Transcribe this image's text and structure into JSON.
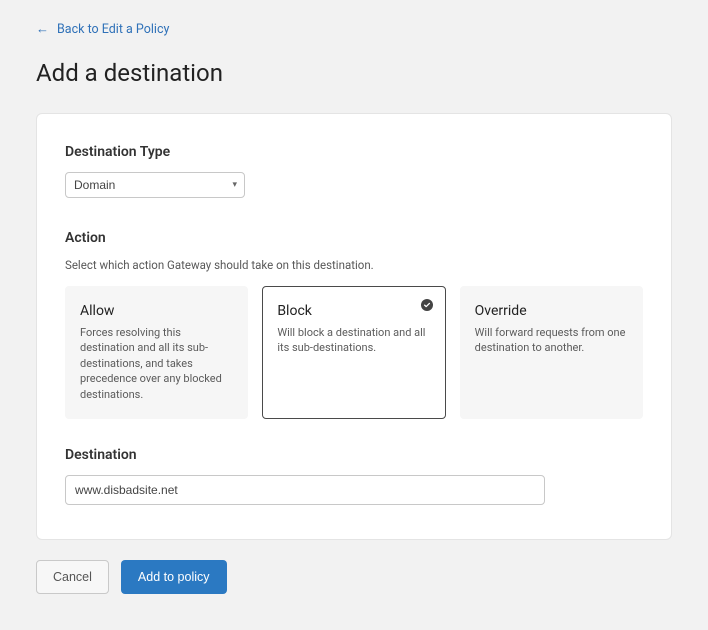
{
  "back_link": "Back to Edit a Policy",
  "page_title": "Add a destination",
  "destination_type": {
    "label": "Destination Type",
    "selected": "Domain"
  },
  "action": {
    "label": "Action",
    "hint": "Select which action Gateway should take on this destination.",
    "options": [
      {
        "title": "Allow",
        "desc": "Forces resolving this destination and all its sub-destinations, and takes precedence over any blocked destinations.",
        "selected": false
      },
      {
        "title": "Block",
        "desc": "Will block a destination and all its sub-destinations.",
        "selected": true
      },
      {
        "title": "Override",
        "desc": "Will forward requests from one destination to another.",
        "selected": false
      }
    ]
  },
  "destination": {
    "label": "Destination",
    "value": "www.disbadsite.net"
  },
  "buttons": {
    "cancel": "Cancel",
    "submit": "Add to policy"
  }
}
